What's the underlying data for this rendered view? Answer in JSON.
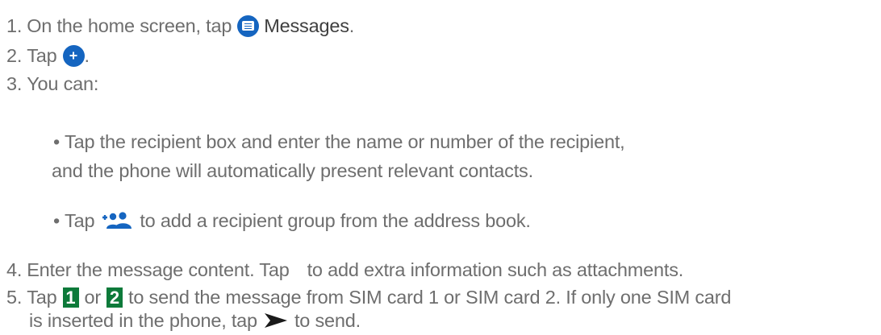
{
  "steps": {
    "s1": {
      "num": "1.",
      "before": "On the home screen, tap",
      "app": "Messages",
      "after": "."
    },
    "s2": {
      "num": "2.",
      "before": "Tap",
      "after": "."
    },
    "s3": {
      "num": "3.",
      "text": "You can:"
    },
    "b1": {
      "bullet": "•",
      "line1": "Tap the recipient box and enter the name or number of the recipient,",
      "line2": "and the phone will automatically present relevant contacts."
    },
    "b2": {
      "bullet": "•",
      "before": "Tap",
      "after": "to add a recipient group from the address book."
    },
    "s4": {
      "num": "4.",
      "before": "Enter the message content. Tap",
      "after": "to add extra information such as attachments."
    },
    "s5": {
      "num": "5.",
      "before": "Tap",
      "sim1": "1",
      "mid": "or",
      "sim2": "2",
      "after": "to send the message from SIM card 1 or SIM card 2. If only one SIM card",
      "line2_before": "is inserted in the phone, tap",
      "line2_after": "to send."
    }
  },
  "icons": {
    "messages": "messages-app-icon",
    "plus": "add-icon",
    "group": "add-group-icon",
    "attach": "attachment-icon",
    "send": "send-icon"
  },
  "colors": {
    "text": "#6e6e6e",
    "accent_blue": "#1565c0",
    "sim_green": "#0d7a3a"
  }
}
